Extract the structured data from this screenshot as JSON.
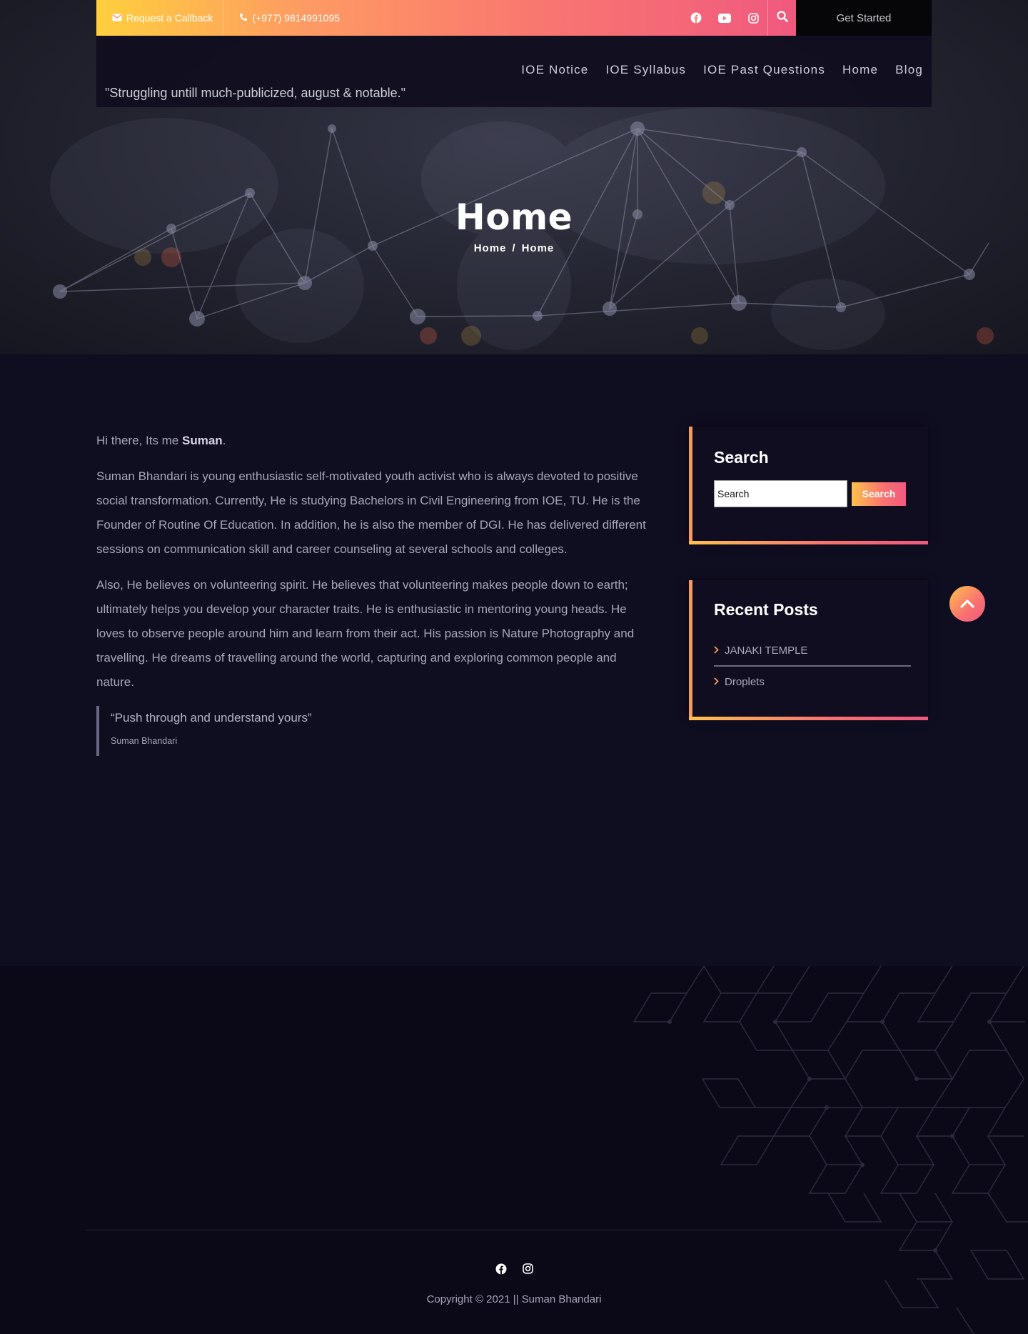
{
  "topbar": {
    "callback_label": "Request a Callback",
    "phone_label": "(+977) 9814991095",
    "get_started_label": "Get Started"
  },
  "nav": {
    "items": [
      "IOE Notice",
      "IOE Syllabus",
      "IOE Past Questions",
      "Home",
      "Blog"
    ],
    "tagline": "\"Struggling untill much-publicized, august & notable.\""
  },
  "hero": {
    "title": "Home",
    "breadcrumb": [
      "Home",
      "/",
      "Home"
    ]
  },
  "content": {
    "intro_prefix": "Hi there, Its me ",
    "intro_name": "Suman",
    "intro_suffix": ".",
    "paragraph1": "Suman Bhandari is young enthusiastic self-motivated youth activist who is always devoted to positive social transformation. Currently, He is studying Bachelors in Civil Engineering from IOE, TU. He is the Founder of Routine Of Education. In addition, he is also the member of DGI. He has delivered different sessions on communication skill and career counseling at several schools and colleges.",
    "paragraph2": "Also, He believes on volunteering spirit. He believes that volunteering makes people down to earth; ultimately helps you develop your character traits. He is enthusiastic in mentoring young heads. He loves to observe people around him and learn from their act. His passion is Nature Photography and travelling. He dreams of travelling around the world, capturing and exploring common people and nature.",
    "quote": "“Push through and understand yours”",
    "quote_author": "Suman Bhandari"
  },
  "sidebar": {
    "search_title": "Search",
    "search_placeholder": "Search",
    "search_button": "Search",
    "recent_title": "Recent Posts",
    "recent_posts": [
      "JANAKI TEMPLE",
      "Droplets"
    ]
  },
  "footer": {
    "copyright": "Copyright © 2021 || Suman Bhandari"
  },
  "icons": {
    "topbar": [
      "envelope-icon",
      "phone-icon",
      "facebook-icon",
      "youtube-icon",
      "instagram-icon",
      "search-icon"
    ],
    "footer": [
      "facebook-icon",
      "instagram-icon"
    ],
    "back_to_top": "chevron-up-icon"
  },
  "colors": {
    "gradient_start": "#fecf3e",
    "gradient_end": "#f0597f",
    "page_background": "#0f0d20",
    "footer_background": "#0b0918"
  }
}
